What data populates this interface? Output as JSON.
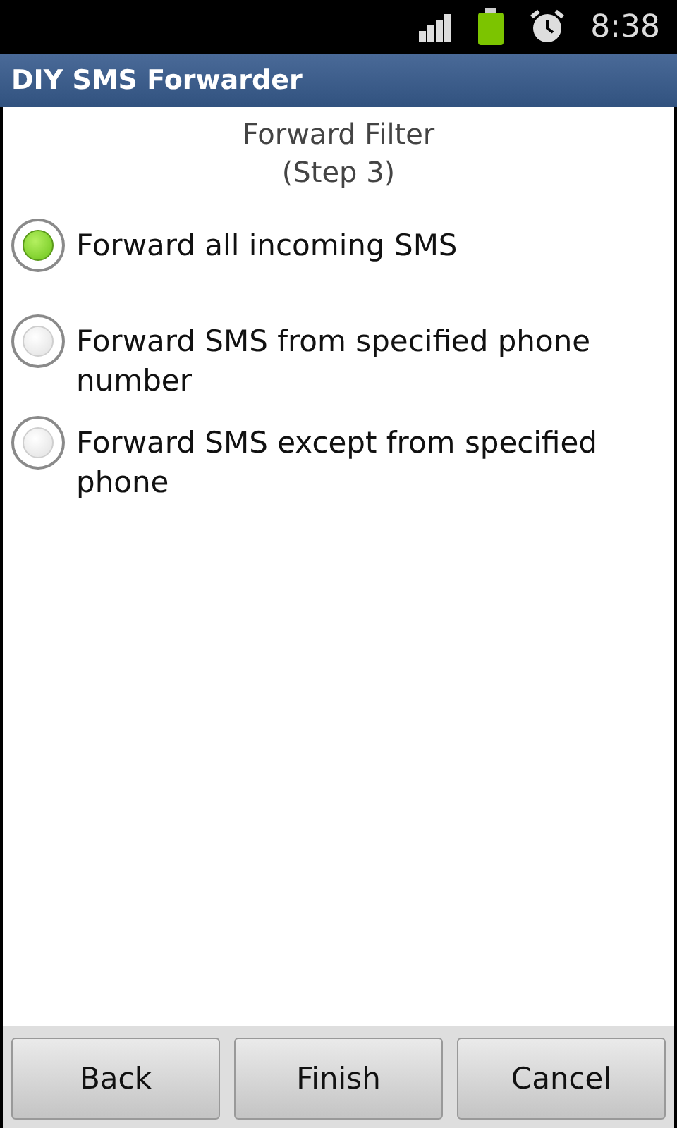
{
  "status_bar": {
    "time": "8:38"
  },
  "window": {
    "title": "DIY SMS Forwarder"
  },
  "heading": {
    "title": "Forward Filter",
    "subtitle": "(Step 3)"
  },
  "options": [
    {
      "label": "Forward all incoming SMS",
      "selected": true
    },
    {
      "label": "Forward SMS from specified phone number",
      "selected": false
    },
    {
      "label": "Forward SMS except from specified phone",
      "selected": false
    }
  ],
  "buttons": [
    "Back",
    "Finish",
    "Cancel"
  ]
}
